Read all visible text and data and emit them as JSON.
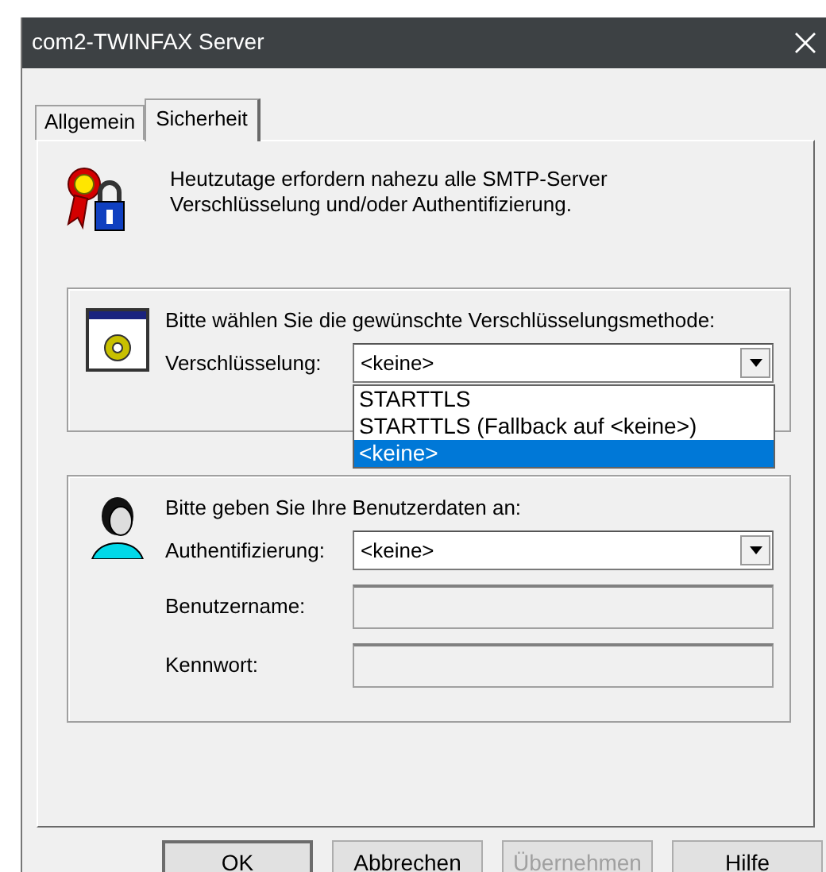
{
  "window": {
    "title": "com2-TWINFAX Server"
  },
  "tabs": [
    {
      "label": "Allgemein",
      "selected": false
    },
    {
      "label": "Sicherheit",
      "selected": true
    }
  ],
  "intro": {
    "text": "Heutzutage erfordern nahezu alle SMTP-Server\nVerschlüsselung und/oder Authentifizierung."
  },
  "encryption": {
    "prompt": "Bitte wählen Sie die gewünschte Verschlüsselungsmethode:",
    "label": "Verschlüsselung:",
    "value": "<keine>",
    "expanded": true,
    "options": [
      {
        "label": "STARTTLS",
        "selected": false
      },
      {
        "label": "STARTTLS (Fallback auf <keine>)",
        "selected": false
      },
      {
        "label": "<keine>",
        "selected": true
      }
    ]
  },
  "credentials": {
    "prompt": "Bitte geben Sie Ihre Benutzerdaten an:",
    "fields": [
      {
        "kind": "combo",
        "label": "Authentifizierung:",
        "value": "<keine>"
      },
      {
        "kind": "text",
        "label": "Benutzername:",
        "disabled": true
      },
      {
        "kind": "text",
        "label": "Kennwort:",
        "disabled": true
      }
    ]
  },
  "buttons": [
    {
      "label": "OK",
      "disabled": false,
      "default": true
    },
    {
      "label": "Abbrechen",
      "disabled": false,
      "default": false
    },
    {
      "label": "Übernehmen",
      "disabled": true,
      "default": false
    },
    {
      "label": "Hilfe",
      "disabled": false,
      "default": false
    }
  ]
}
